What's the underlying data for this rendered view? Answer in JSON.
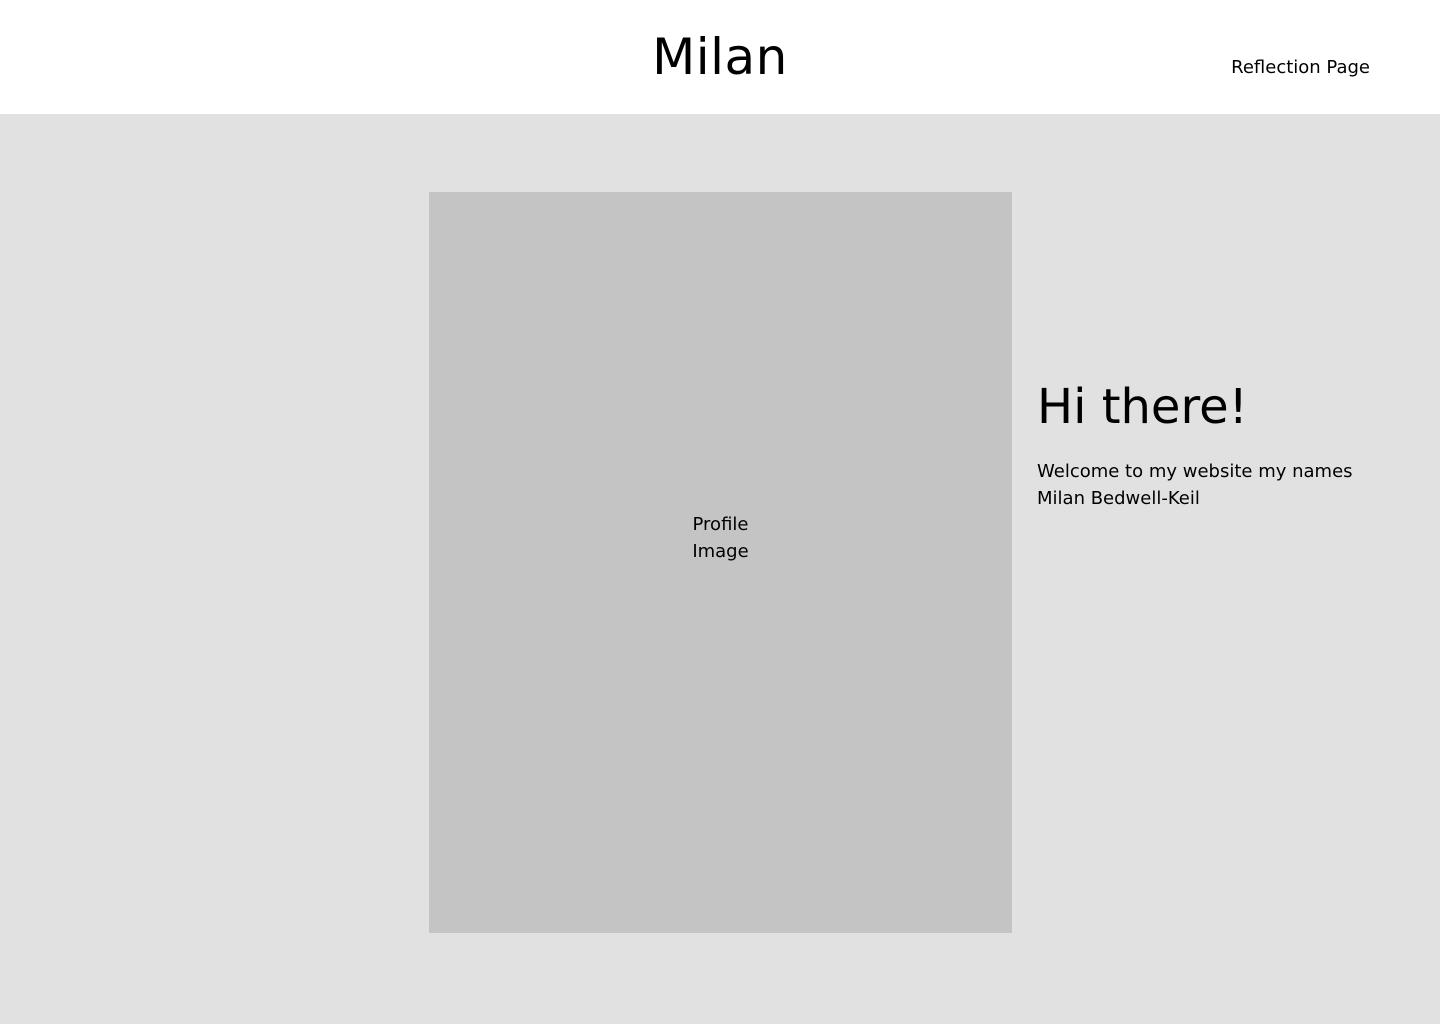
{
  "header": {
    "site_title": "Milan",
    "nav": {
      "reflection_link": "Reflection Page"
    }
  },
  "main": {
    "profile_image": {
      "label": "Profile Image"
    },
    "intro": {
      "heading": "Hi there!",
      "text": "Welcome to my website my names Milan Bedwell-Keil"
    }
  },
  "colors": {
    "header_bg": "#ffffff",
    "main_bg": "#e1e1e1",
    "placeholder_bg": "#c4c4c4",
    "text": "#000000"
  }
}
